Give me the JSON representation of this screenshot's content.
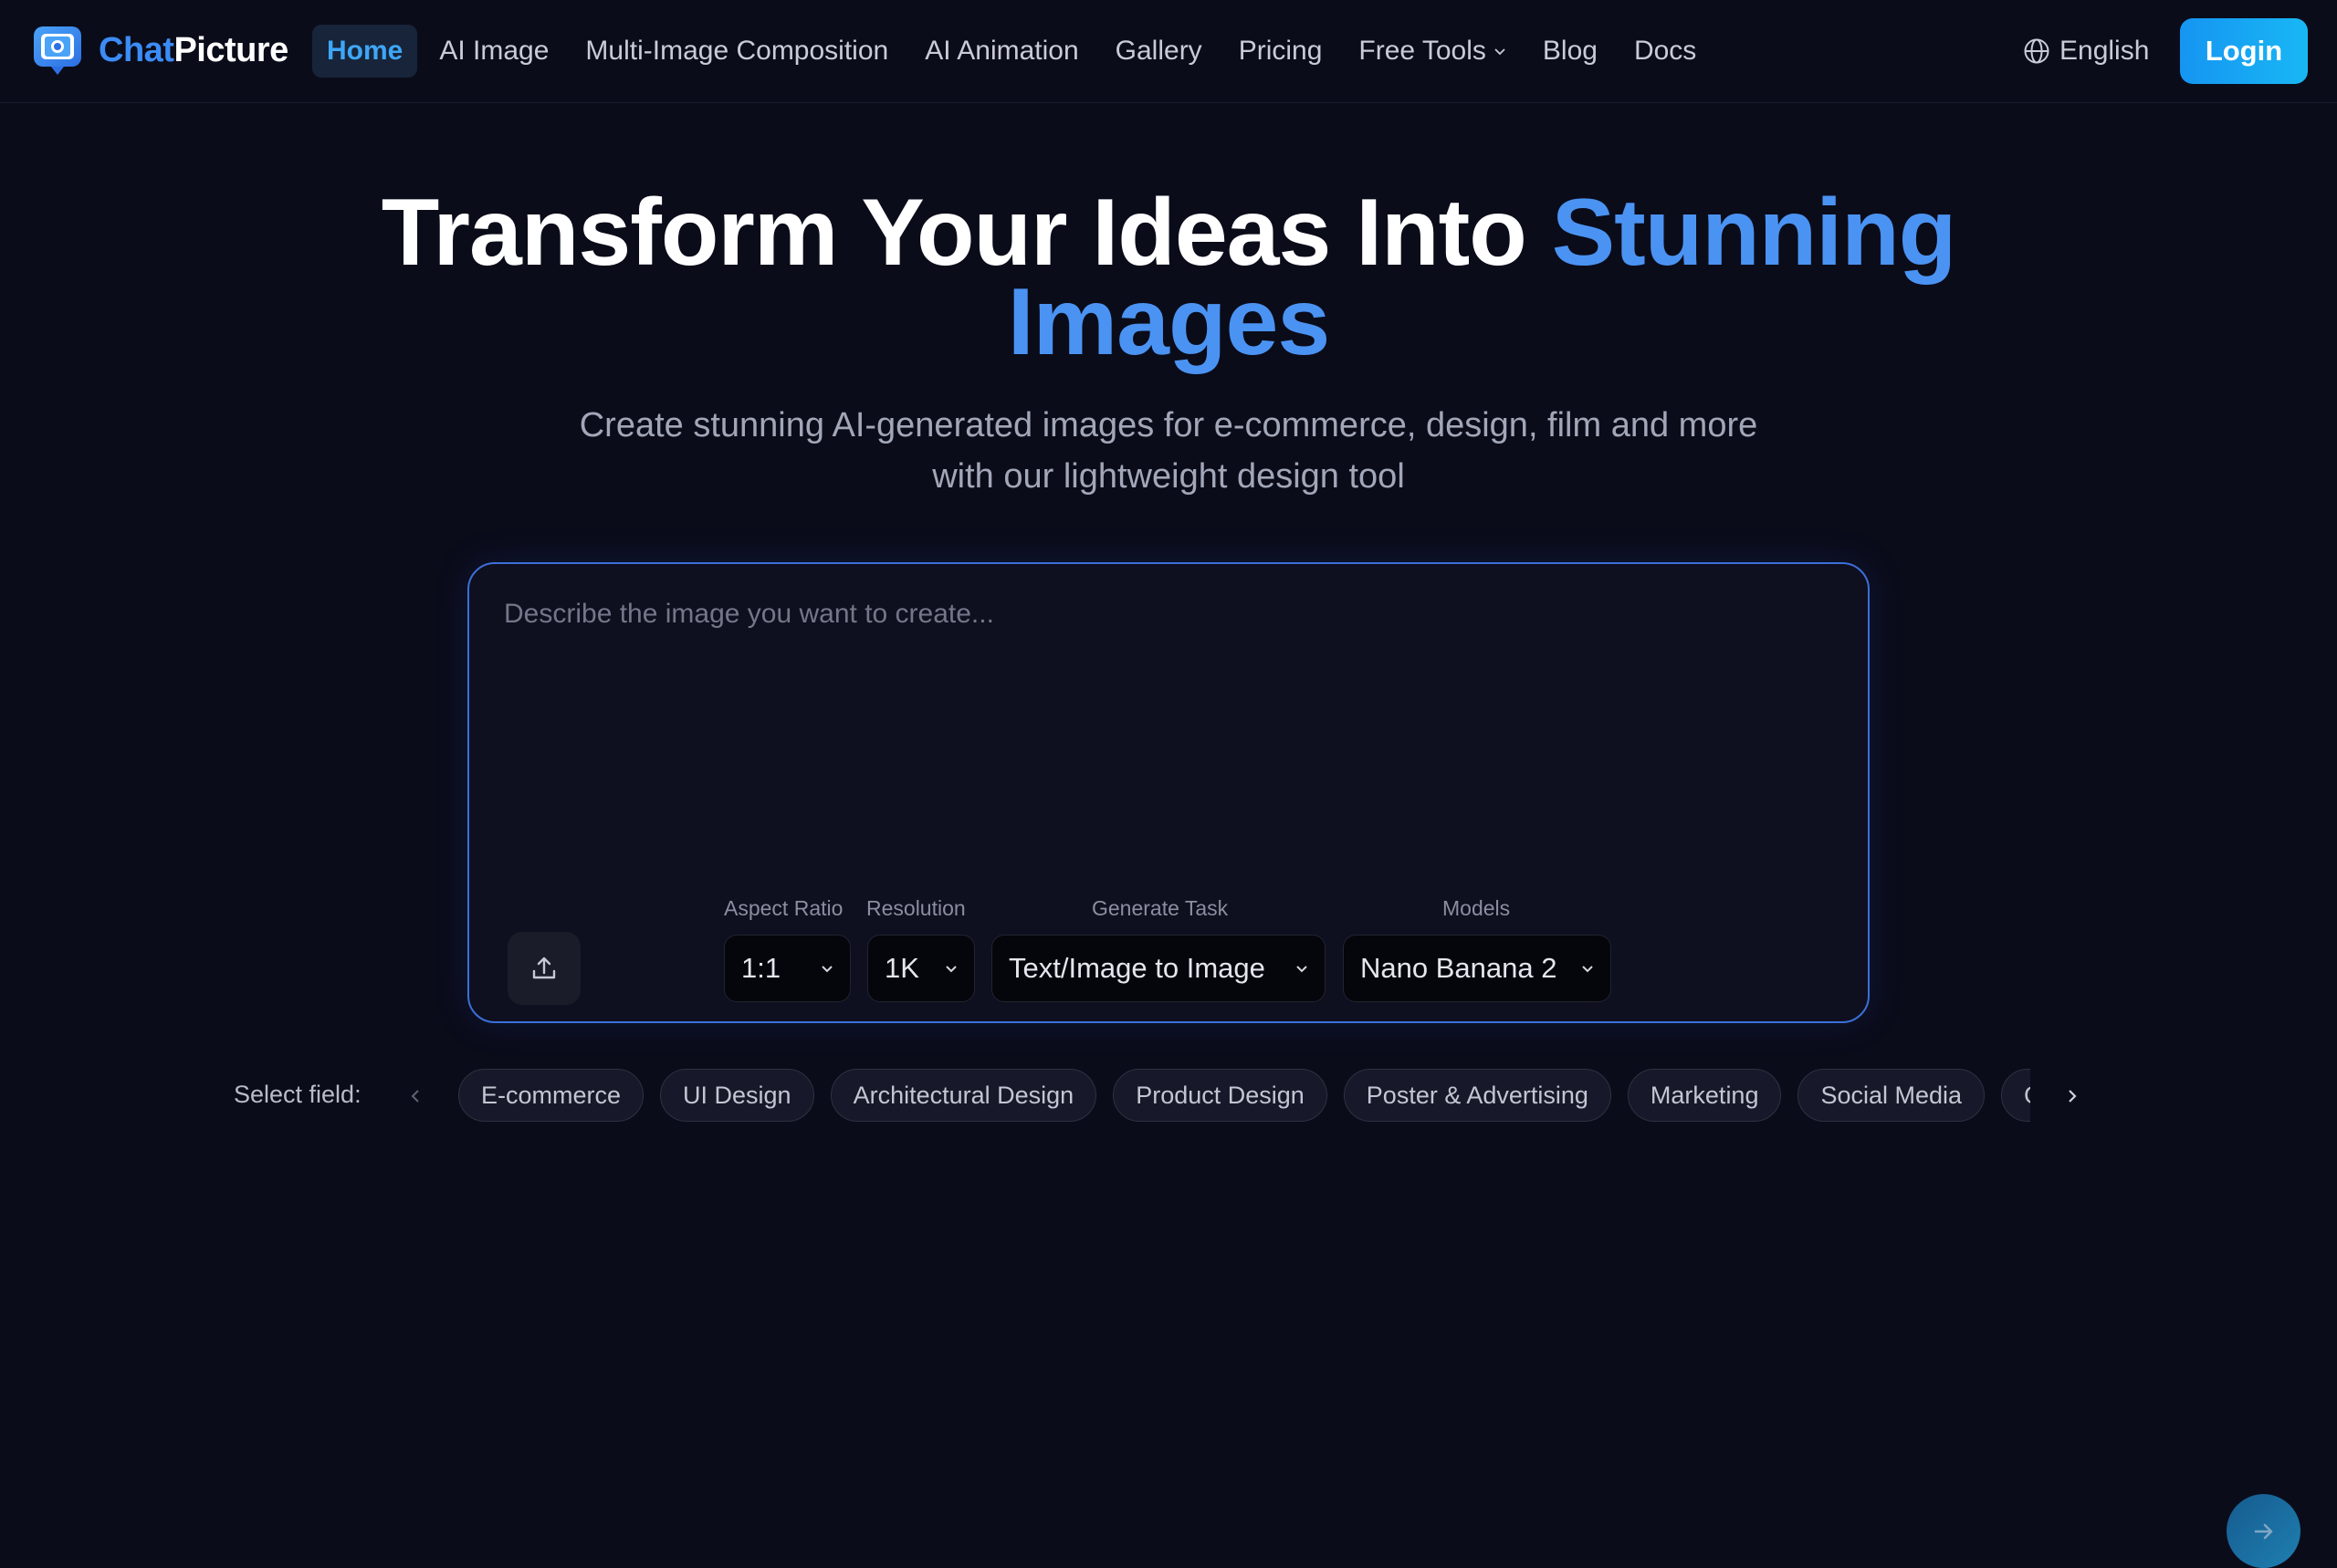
{
  "brand": {
    "part1": "Chat",
    "part2": "Picture"
  },
  "nav": {
    "items": [
      {
        "label": "Home"
      },
      {
        "label": "AI Image"
      },
      {
        "label": "Multi-Image Composition"
      },
      {
        "label": "AI Animation"
      },
      {
        "label": "Gallery"
      },
      {
        "label": "Pricing"
      },
      {
        "label": "Free Tools"
      },
      {
        "label": "Blog"
      },
      {
        "label": "Docs"
      }
    ],
    "language": "English",
    "login": "Login"
  },
  "hero": {
    "title_main": "Transform Your Ideas Into ",
    "title_accent_1": "Stunning",
    "title_accent_2": "Images",
    "subtitle_line1": "Create stunning AI-generated images for e-commerce, design, film and more",
    "subtitle_line2": "with our lightweight design tool"
  },
  "prompt": {
    "placeholder": "Describe the image you want to create...",
    "value": ""
  },
  "controls": {
    "aspect_ratio": {
      "label": "Aspect Ratio",
      "value": "1:1"
    },
    "resolution": {
      "label": "Resolution",
      "value": "1K"
    },
    "task": {
      "label": "Generate Task",
      "value": "Text/Image to Image"
    },
    "model": {
      "label": "Models",
      "value": "Nano Banana 2"
    }
  },
  "fields": {
    "label": "Select field:",
    "chips": [
      "E-commerce",
      "UI Design",
      "Architectural Design",
      "Product Design",
      "Poster & Advertising",
      "Marketing",
      "Social Media",
      "Game"
    ]
  },
  "colors": {
    "background": "#0b0c1a",
    "accent": "#4b93f3",
    "login_gradient_start": "#1595f2",
    "login_gradient_end": "#19b7f4"
  },
  "icons": [
    "logo-icon",
    "chevron-down-icon",
    "globe-icon",
    "upload-icon",
    "arrow-right-icon",
    "chevron-left-icon",
    "chevron-right-icon"
  ]
}
